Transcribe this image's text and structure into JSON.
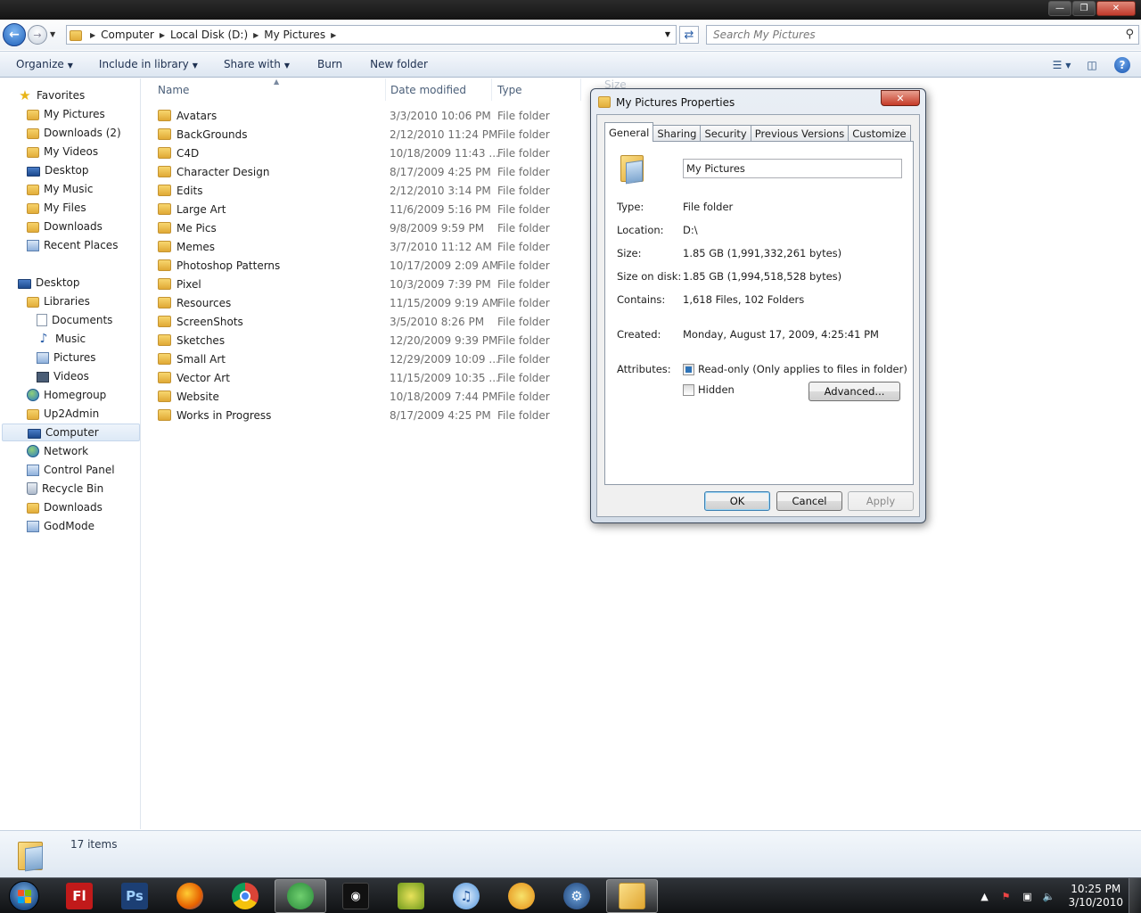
{
  "address": {
    "crumbs": [
      "Computer",
      "Local Disk (D:)",
      "My Pictures"
    ],
    "search_placeholder": "Search My Pictures"
  },
  "toolbar": {
    "organize": "Organize",
    "include_in_library": "Include in library",
    "share_with": "Share with",
    "burn": "Burn",
    "new_folder": "New folder"
  },
  "nav": {
    "favorites_header": "Favorites",
    "favorites": [
      "My Pictures",
      "Downloads (2)",
      "My Videos",
      "Desktop",
      "My Music",
      "My Files",
      "Downloads",
      "Recent Places"
    ],
    "desktop_header": "Desktop",
    "libraries": "Libraries",
    "library_items": [
      "Documents",
      "Music",
      "Pictures",
      "Videos"
    ],
    "others": [
      "Homegroup",
      "Up2Admin",
      "Computer",
      "Network",
      "Control Panel",
      "Recycle Bin",
      "Downloads",
      "GodMode"
    ]
  },
  "columns": {
    "name": "Name",
    "date": "Date modified",
    "type": "Type",
    "size": "Size"
  },
  "files": [
    {
      "name": "Avatars",
      "date": "3/3/2010 10:06 PM",
      "type": "File folder"
    },
    {
      "name": "BackGrounds",
      "date": "2/12/2010 11:24 PM",
      "type": "File folder"
    },
    {
      "name": "C4D",
      "date": "10/18/2009 11:43 ...",
      "type": "File folder"
    },
    {
      "name": "Character Design",
      "date": "8/17/2009 4:25 PM",
      "type": "File folder"
    },
    {
      "name": "Edits",
      "date": "2/12/2010 3:14 PM",
      "type": "File folder"
    },
    {
      "name": "Large Art",
      "date": "11/6/2009 5:16 PM",
      "type": "File folder"
    },
    {
      "name": "Me Pics",
      "date": "9/8/2009 9:59 PM",
      "type": "File folder"
    },
    {
      "name": "Memes",
      "date": "3/7/2010 11:12 AM",
      "type": "File folder"
    },
    {
      "name": "Photoshop Patterns",
      "date": "10/17/2009 2:09 AM",
      "type": "File folder"
    },
    {
      "name": "Pixel",
      "date": "10/3/2009 7:39 PM",
      "type": "File folder"
    },
    {
      "name": "Resources",
      "date": "11/15/2009 9:19 AM",
      "type": "File folder"
    },
    {
      "name": "ScreenShots",
      "date": "3/5/2010 8:26 PM",
      "type": "File folder"
    },
    {
      "name": "Sketches",
      "date": "12/20/2009 9:39 PM",
      "type": "File folder"
    },
    {
      "name": "Small Art",
      "date": "12/29/2009 10:09 ...",
      "type": "File folder"
    },
    {
      "name": "Vector Art",
      "date": "11/15/2009 10:35 ...",
      "type": "File folder"
    },
    {
      "name": "Website",
      "date": "10/18/2009 7:44 PM",
      "type": "File folder"
    },
    {
      "name": "Works in Progress",
      "date": "8/17/2009 4:25 PM",
      "type": "File folder"
    }
  ],
  "status": {
    "items": "17 items"
  },
  "dialog": {
    "title": "My Pictures Properties",
    "tabs": [
      "General",
      "Sharing",
      "Security",
      "Previous Versions",
      "Customize"
    ],
    "name_value": "My Pictures",
    "type_label": "Type:",
    "type_value": "File folder",
    "location_label": "Location:",
    "location_value": "D:\\",
    "size_label": "Size:",
    "size_value": "1.85 GB (1,991,332,261 bytes)",
    "size_on_disk_label": "Size on disk:",
    "size_on_disk_value": "1.85 GB (1,994,518,528 bytes)",
    "contains_label": "Contains:",
    "contains_value": "1,618 Files, 102 Folders",
    "created_label": "Created:",
    "created_value": "Monday, August 17, 2009, 4:25:41 PM",
    "attributes_label": "Attributes:",
    "readonly_label": "Read-only (Only applies to files in folder)",
    "hidden_label": "Hidden",
    "advanced": "Advanced...",
    "ok": "OK",
    "cancel": "Cancel",
    "apply": "Apply"
  },
  "taskbar": {
    "apps": [
      "flash-icon",
      "photoshop-icon",
      "firefox-icon",
      "chrome-icon",
      "messenger-icon",
      "steam-icon",
      "xsplit-icon",
      "itunes-icon",
      "fl-studio-icon",
      "settings-icon",
      "explorer-icon"
    ],
    "flash_label": "Fl",
    "ps_label": "Ps",
    "time": "10:25 PM",
    "date": "3/10/2010"
  }
}
